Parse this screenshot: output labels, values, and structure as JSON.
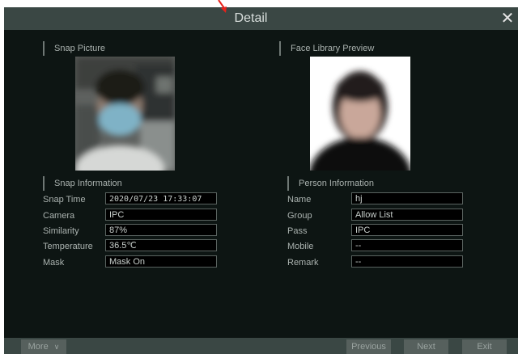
{
  "window": {
    "title": "Detail",
    "close_icon": "close-icon"
  },
  "snap": {
    "picture_heading": "Snap Picture",
    "info_heading": "Snap Information",
    "fields": [
      {
        "label": "Snap Time",
        "value": "2020/07/23 17:33:07"
      },
      {
        "label": "Camera",
        "value": "IPC"
      },
      {
        "label": "Similarity",
        "value": "87%"
      },
      {
        "label": "Temperature",
        "value": "36.5℃"
      },
      {
        "label": "Mask",
        "value": "Mask On"
      }
    ]
  },
  "library": {
    "preview_heading": "Face Library Preview",
    "info_heading": "Person Information",
    "fields": [
      {
        "label": "Name",
        "value": "hj"
      },
      {
        "label": "Group",
        "value": "Allow List"
      },
      {
        "label": "Pass",
        "value": "IPC"
      },
      {
        "label": "Mobile",
        "value": "--"
      },
      {
        "label": "Remark",
        "value": "--"
      }
    ]
  },
  "footer": {
    "more": "More",
    "previous": "Previous",
    "next": "Next",
    "exit": "Exit"
  },
  "colors": {
    "background": "#0d1513",
    "bar": "#3a4744",
    "button": "#56605d",
    "pointer": "#e8221b"
  }
}
